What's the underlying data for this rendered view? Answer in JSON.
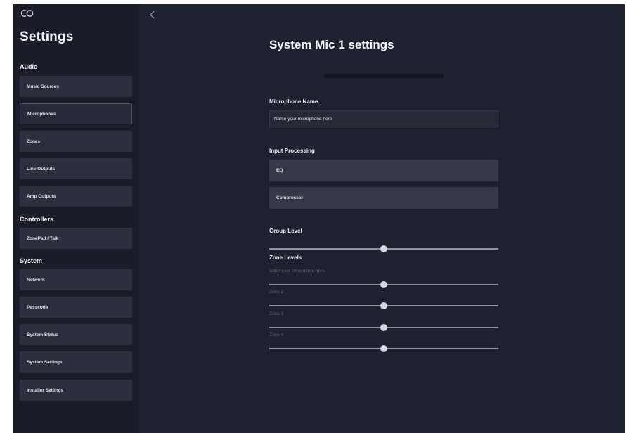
{
  "sidebar": {
    "logo_icon": "ca-logo-icon",
    "title": "Settings",
    "sections": {
      "audio": "Audio",
      "controllers": "Controllers",
      "system": "System"
    },
    "items": [
      {
        "label": "Music Sources"
      },
      {
        "label": "Microphones",
        "active": true
      },
      {
        "label": "Zones"
      },
      {
        "label": "Line Outputs"
      },
      {
        "label": "Amp Outputs"
      },
      {
        "label": "ZonePad / Talk"
      },
      {
        "label": "Network"
      },
      {
        "label": "Passcode"
      },
      {
        "label": "System Status"
      },
      {
        "label": "System Settings"
      },
      {
        "label": "Installer Settings"
      }
    ]
  },
  "header": {
    "back_icon": "chevron-left-icon"
  },
  "main": {
    "title": "System Mic 1 settings",
    "microphone_name": {
      "label": "Microphone Name",
      "value": "",
      "placeholder": "Name your microphone here"
    },
    "input_processing": {
      "label": "Input Processing",
      "buttons": [
        "EQ",
        "Compressor"
      ]
    },
    "group_level": {
      "label": "Group Level",
      "value_fraction": 0.5
    },
    "zone_levels": {
      "label": "Zone Levels",
      "zones": [
        {
          "name": "Enter your zone name here",
          "value_fraction": 0.5
        },
        {
          "name": "Zone 2",
          "value_fraction": 0.5
        },
        {
          "name": "Zone 3",
          "value_fraction": 0.5
        },
        {
          "name": "Zone 4",
          "value_fraction": 0.5
        }
      ]
    }
  },
  "colors": {
    "background": "#1e2130",
    "sidebar": "#1a1d27",
    "nav_item": "#2c303e",
    "button": "#343847",
    "slider_track": "#8e93a1",
    "slider_thumb": "#d5d8e0"
  }
}
